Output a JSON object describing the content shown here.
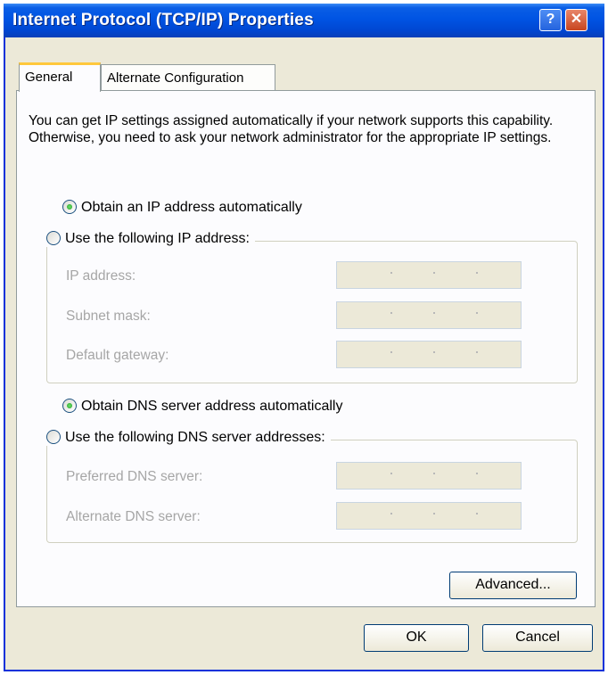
{
  "window": {
    "title": "Internet Protocol (TCP/IP) Properties",
    "help_glyph": "?",
    "close_glyph": "✕"
  },
  "tabs": [
    {
      "label": "General",
      "selected": true
    },
    {
      "label": "Alternate Configuration",
      "selected": false
    }
  ],
  "description": "You can get IP settings assigned automatically if your network supports this capability. Otherwise, you need to ask your network administrator for the appropriate IP settings.",
  "ip_section": {
    "auto_option": "Obtain an IP address automatically",
    "manual_option": "Use the following IP address:",
    "selected": "auto",
    "fields": [
      {
        "label": "IP address:",
        "value": ""
      },
      {
        "label": "Subnet mask:",
        "value": ""
      },
      {
        "label": "Default gateway:",
        "value": ""
      }
    ]
  },
  "dns_section": {
    "auto_option": "Obtain DNS server address automatically",
    "manual_option": "Use the following DNS server addresses:",
    "selected": "auto",
    "fields": [
      {
        "label": "Preferred DNS server:",
        "value": ""
      },
      {
        "label": "Alternate DNS server:",
        "value": ""
      }
    ]
  },
  "buttons": {
    "advanced": "Advanced...",
    "ok": "OK",
    "cancel": "Cancel"
  }
}
